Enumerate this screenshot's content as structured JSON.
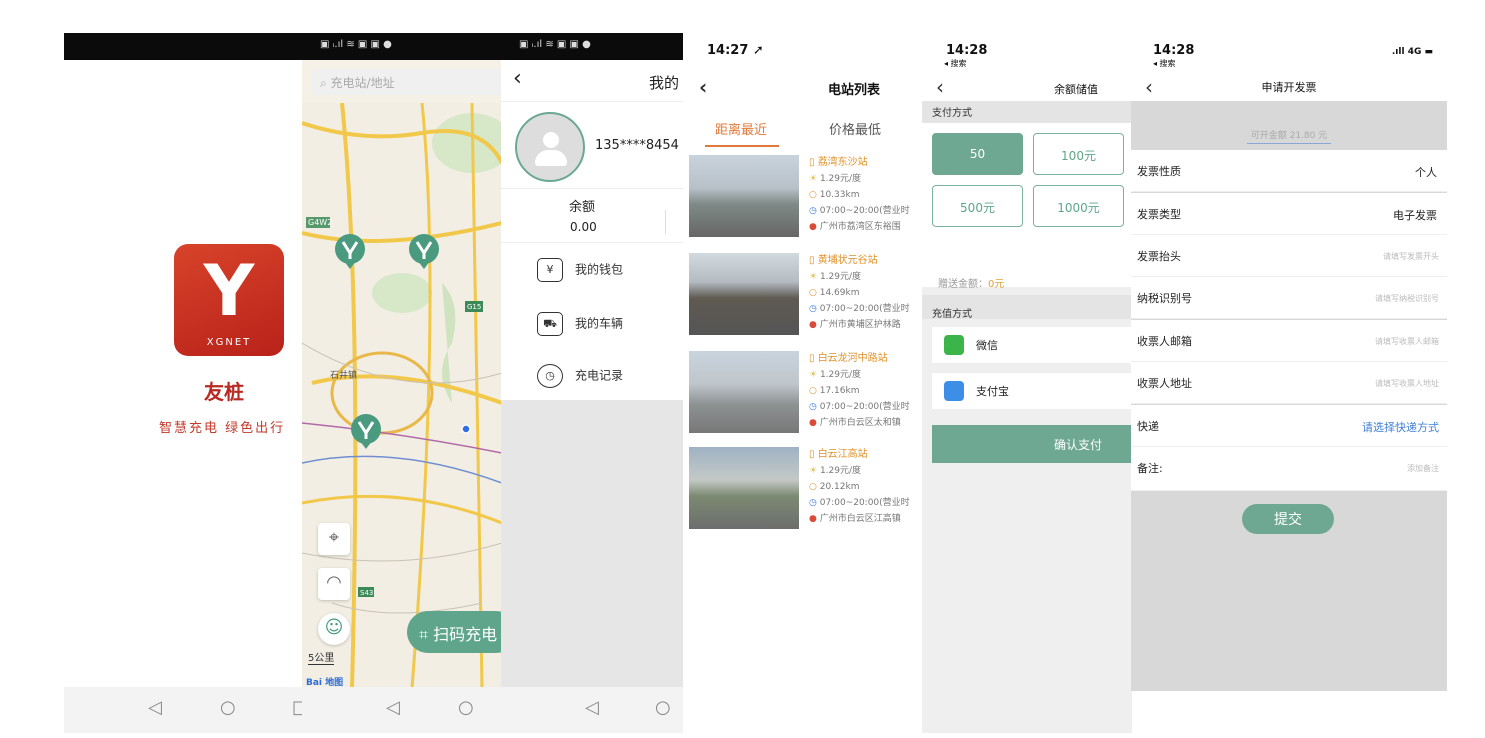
{
  "splash": {
    "logo_text": "XGNET",
    "app_name": "友桩",
    "slogan": "智慧充电 绿色出行"
  },
  "map_screen": {
    "search_placeholder": "充电站/地址",
    "scan_button": "扫码充电",
    "scale_label": "5公里",
    "map_labels": [
      "G4W2",
      "G15",
      "石井镇",
      "S43"
    ],
    "baidu_logo": "Bai 地图"
  },
  "profile": {
    "title": "我的",
    "phone": "135****8454",
    "balance_label": "余额",
    "balance_value": "0.00",
    "menu": [
      {
        "label": "我的钱包",
        "icon": "wallet-icon"
      },
      {
        "label": "我的车辆",
        "icon": "car-icon"
      },
      {
        "label": "充电记录",
        "icon": "clock-icon"
      }
    ]
  },
  "station_list": {
    "time": "14:27",
    "title": "电站列表",
    "tabs": [
      "距离最近",
      "价格最低"
    ],
    "stations": [
      {
        "name": "荔湾东沙站",
        "price": "1.29元/度",
        "distance": "10.33km",
        "hours": "07:00~20:00(营业时",
        "address": "广州市荔湾区东裕围"
      },
      {
        "name": "黄埔状元谷站",
        "price": "1.29元/度",
        "distance": "14.69km",
        "hours": "07:00~20:00(营业时",
        "address": "广州市黄埔区护林路"
      },
      {
        "name": "白云龙河中路站",
        "price": "1.29元/度",
        "distance": "17.16km",
        "hours": "07:00~20:00(营业时",
        "address": "广州市白云区太和镇"
      },
      {
        "name": "白云江高站",
        "price": "1.29元/度",
        "distance": "20.12km",
        "hours": "07:00~20:00(营业时",
        "address": "广州市白云区江高镇"
      }
    ]
  },
  "recharge": {
    "time": "14:28",
    "back_label": "◂ 搜索",
    "title": "余额储值",
    "pay_section": "支付方式",
    "amounts": [
      "50",
      "100元",
      "500元",
      "1000元"
    ],
    "bonus_label": "赠送金额：",
    "bonus_value": "0元",
    "method_section": "充值方式",
    "methods": [
      "微信",
      "支付宝"
    ],
    "confirm": "确认支付"
  },
  "invoice": {
    "time": "14:28",
    "back_label": "◂ 搜索",
    "signal": "4G",
    "title": "申请开发票",
    "available": "可开金额 21.80 元",
    "rows": [
      {
        "label": "发票性质",
        "value": "个人",
        "kind": "value"
      },
      {
        "label": "发票类型",
        "value": "电子发票",
        "kind": "value"
      },
      {
        "label": "发票抬头",
        "value": "请填写发票开头",
        "kind": "placeholder"
      },
      {
        "label": "纳税识别号",
        "value": "请填写纳税识别号",
        "kind": "placeholder"
      },
      {
        "label": "收票人邮箱",
        "value": "请填写收票人邮箱",
        "kind": "placeholder"
      },
      {
        "label": "收票人地址",
        "value": "请填写收票人地址",
        "kind": "placeholder"
      },
      {
        "label": "快递",
        "value": "请选择快递方式",
        "kind": "link"
      },
      {
        "label": "备注:",
        "value": "添加备注",
        "kind": "placeholder"
      }
    ],
    "submit": "提交"
  },
  "colors": {
    "brand_green": "#6ea893",
    "brand_red": "#c0392b",
    "accent_orange": "#e07a3a",
    "link_blue": "#3f7fd6"
  }
}
